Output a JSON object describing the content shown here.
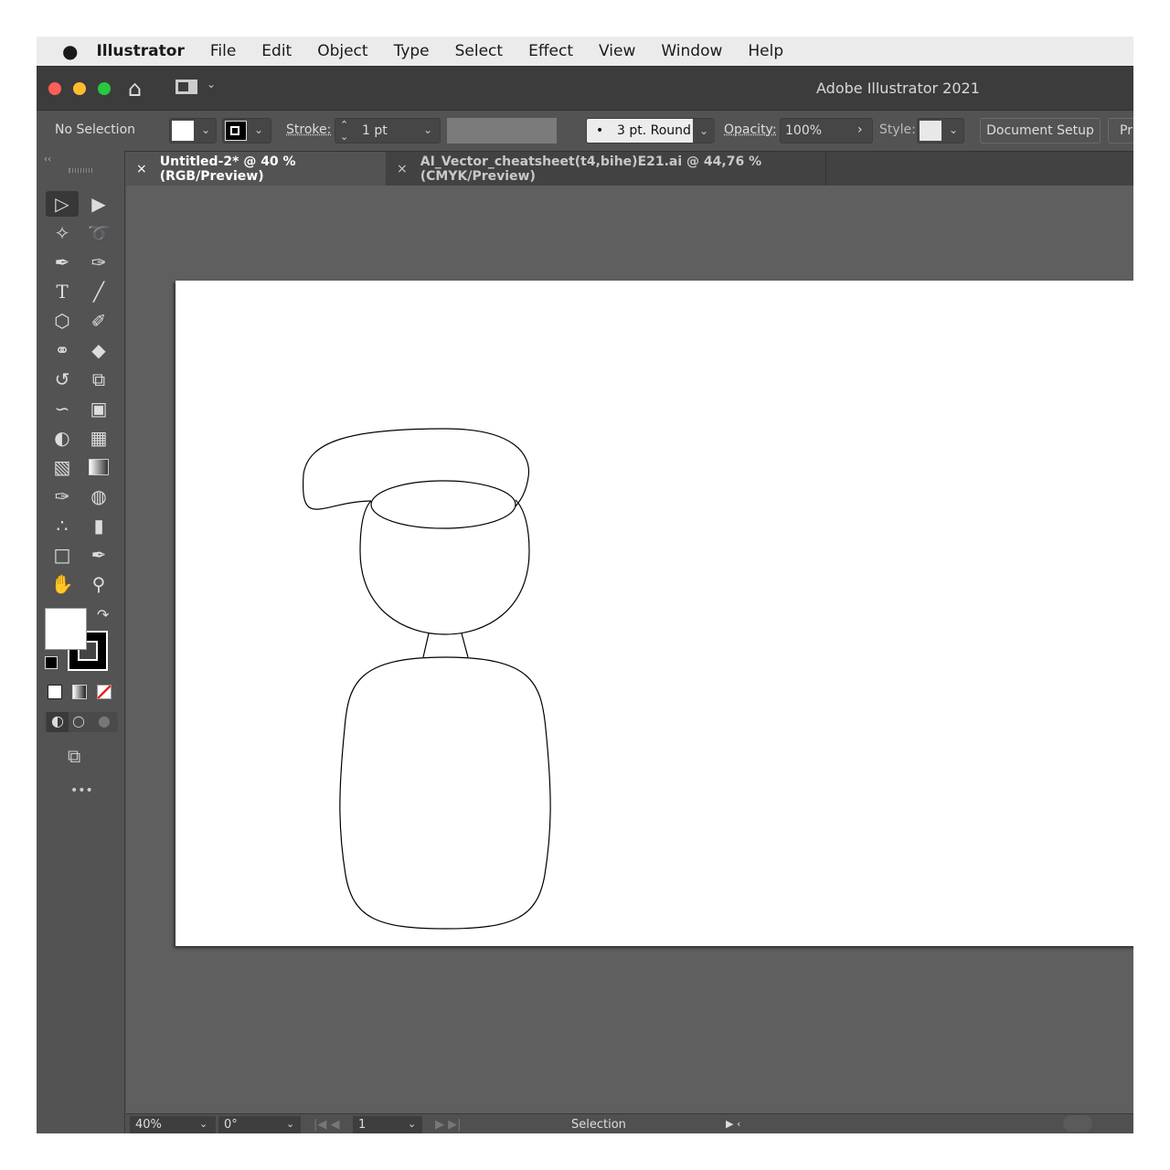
{
  "menubar": {
    "apple": "",
    "app": "Illustrator",
    "items": [
      "File",
      "Edit",
      "Object",
      "Type",
      "Select",
      "Effect",
      "View",
      "Window",
      "Help"
    ]
  },
  "titlebar": {
    "title": "Adobe Illustrator 2021"
  },
  "control": {
    "selection": "No Selection",
    "stroke_label": "Stroke:",
    "stroke_value": "1 pt",
    "brush": "3 pt. Round",
    "opacity_label": "Opacity:",
    "opacity_value": "100%",
    "style_label": "Style:",
    "document_setup": "Document Setup",
    "preferences": "Pr"
  },
  "tabs": [
    {
      "label": "Untitled-2* @ 40 % (RGB/Preview)",
      "close": "×"
    },
    {
      "label": "AI_Vector_cheatsheet(t4,bihe)E21.ai @ 44,76 % (CMYK/Preview)",
      "close": "×"
    }
  ],
  "toolbar": {
    "collapse": "‹‹",
    "more": "•••"
  },
  "status": {
    "zoom": "40%",
    "rotation": "0°",
    "artboard": "1",
    "tool": "Selection"
  },
  "colors": {
    "menubar": "#ebebeb",
    "titlebar": "#3c3c3c",
    "panel": "#535353",
    "canvas": "#5f5f5f"
  }
}
